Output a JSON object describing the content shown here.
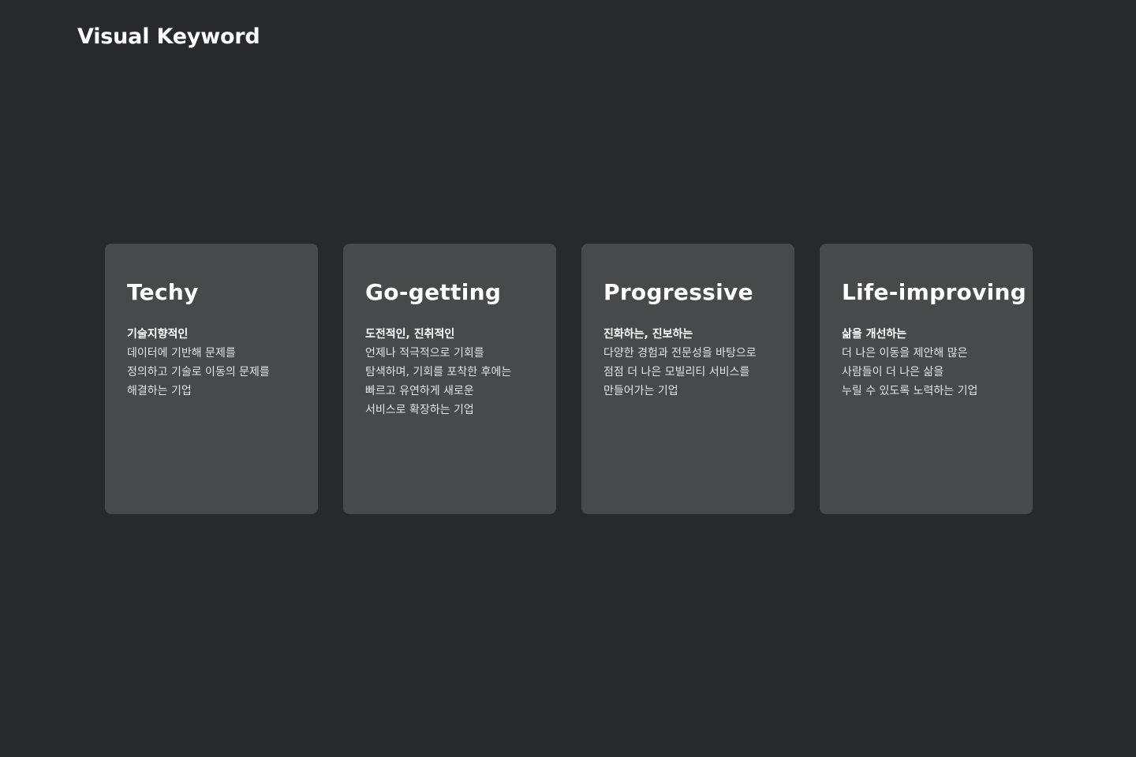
{
  "header": {
    "title": "Visual Keyword"
  },
  "cards": [
    {
      "title": "Techy",
      "subtitle": "기술지향적인",
      "lines": [
        "데이터에 기반해 문제를",
        "정의하고 기술로 이동의 문제를",
        "해결하는 기업"
      ]
    },
    {
      "title": "Go-getting",
      "subtitle": "도전적인, 진취적인",
      "lines": [
        "언제나 적극적으로 기회를",
        "탐색하며, 기회를 포착한 후에는",
        "빠르고 유연하게 새로운",
        "서비스로 확장하는 기업"
      ]
    },
    {
      "title": "Progressive",
      "subtitle": "진화하는, 진보하는",
      "lines": [
        "다양한 경험과 전문성을 바탕으로",
        "점점 더 나은 모빌리티 서비스를",
        "만들어가는 기업"
      ]
    },
    {
      "title": "Life-improving",
      "subtitle": "삶을 개선하는",
      "lines": [
        "더 나은 이동을 제안해 많은",
        "사람들이 더 나은 삶을",
        "누릴 수 있도록 노력하는 기업"
      ]
    }
  ]
}
